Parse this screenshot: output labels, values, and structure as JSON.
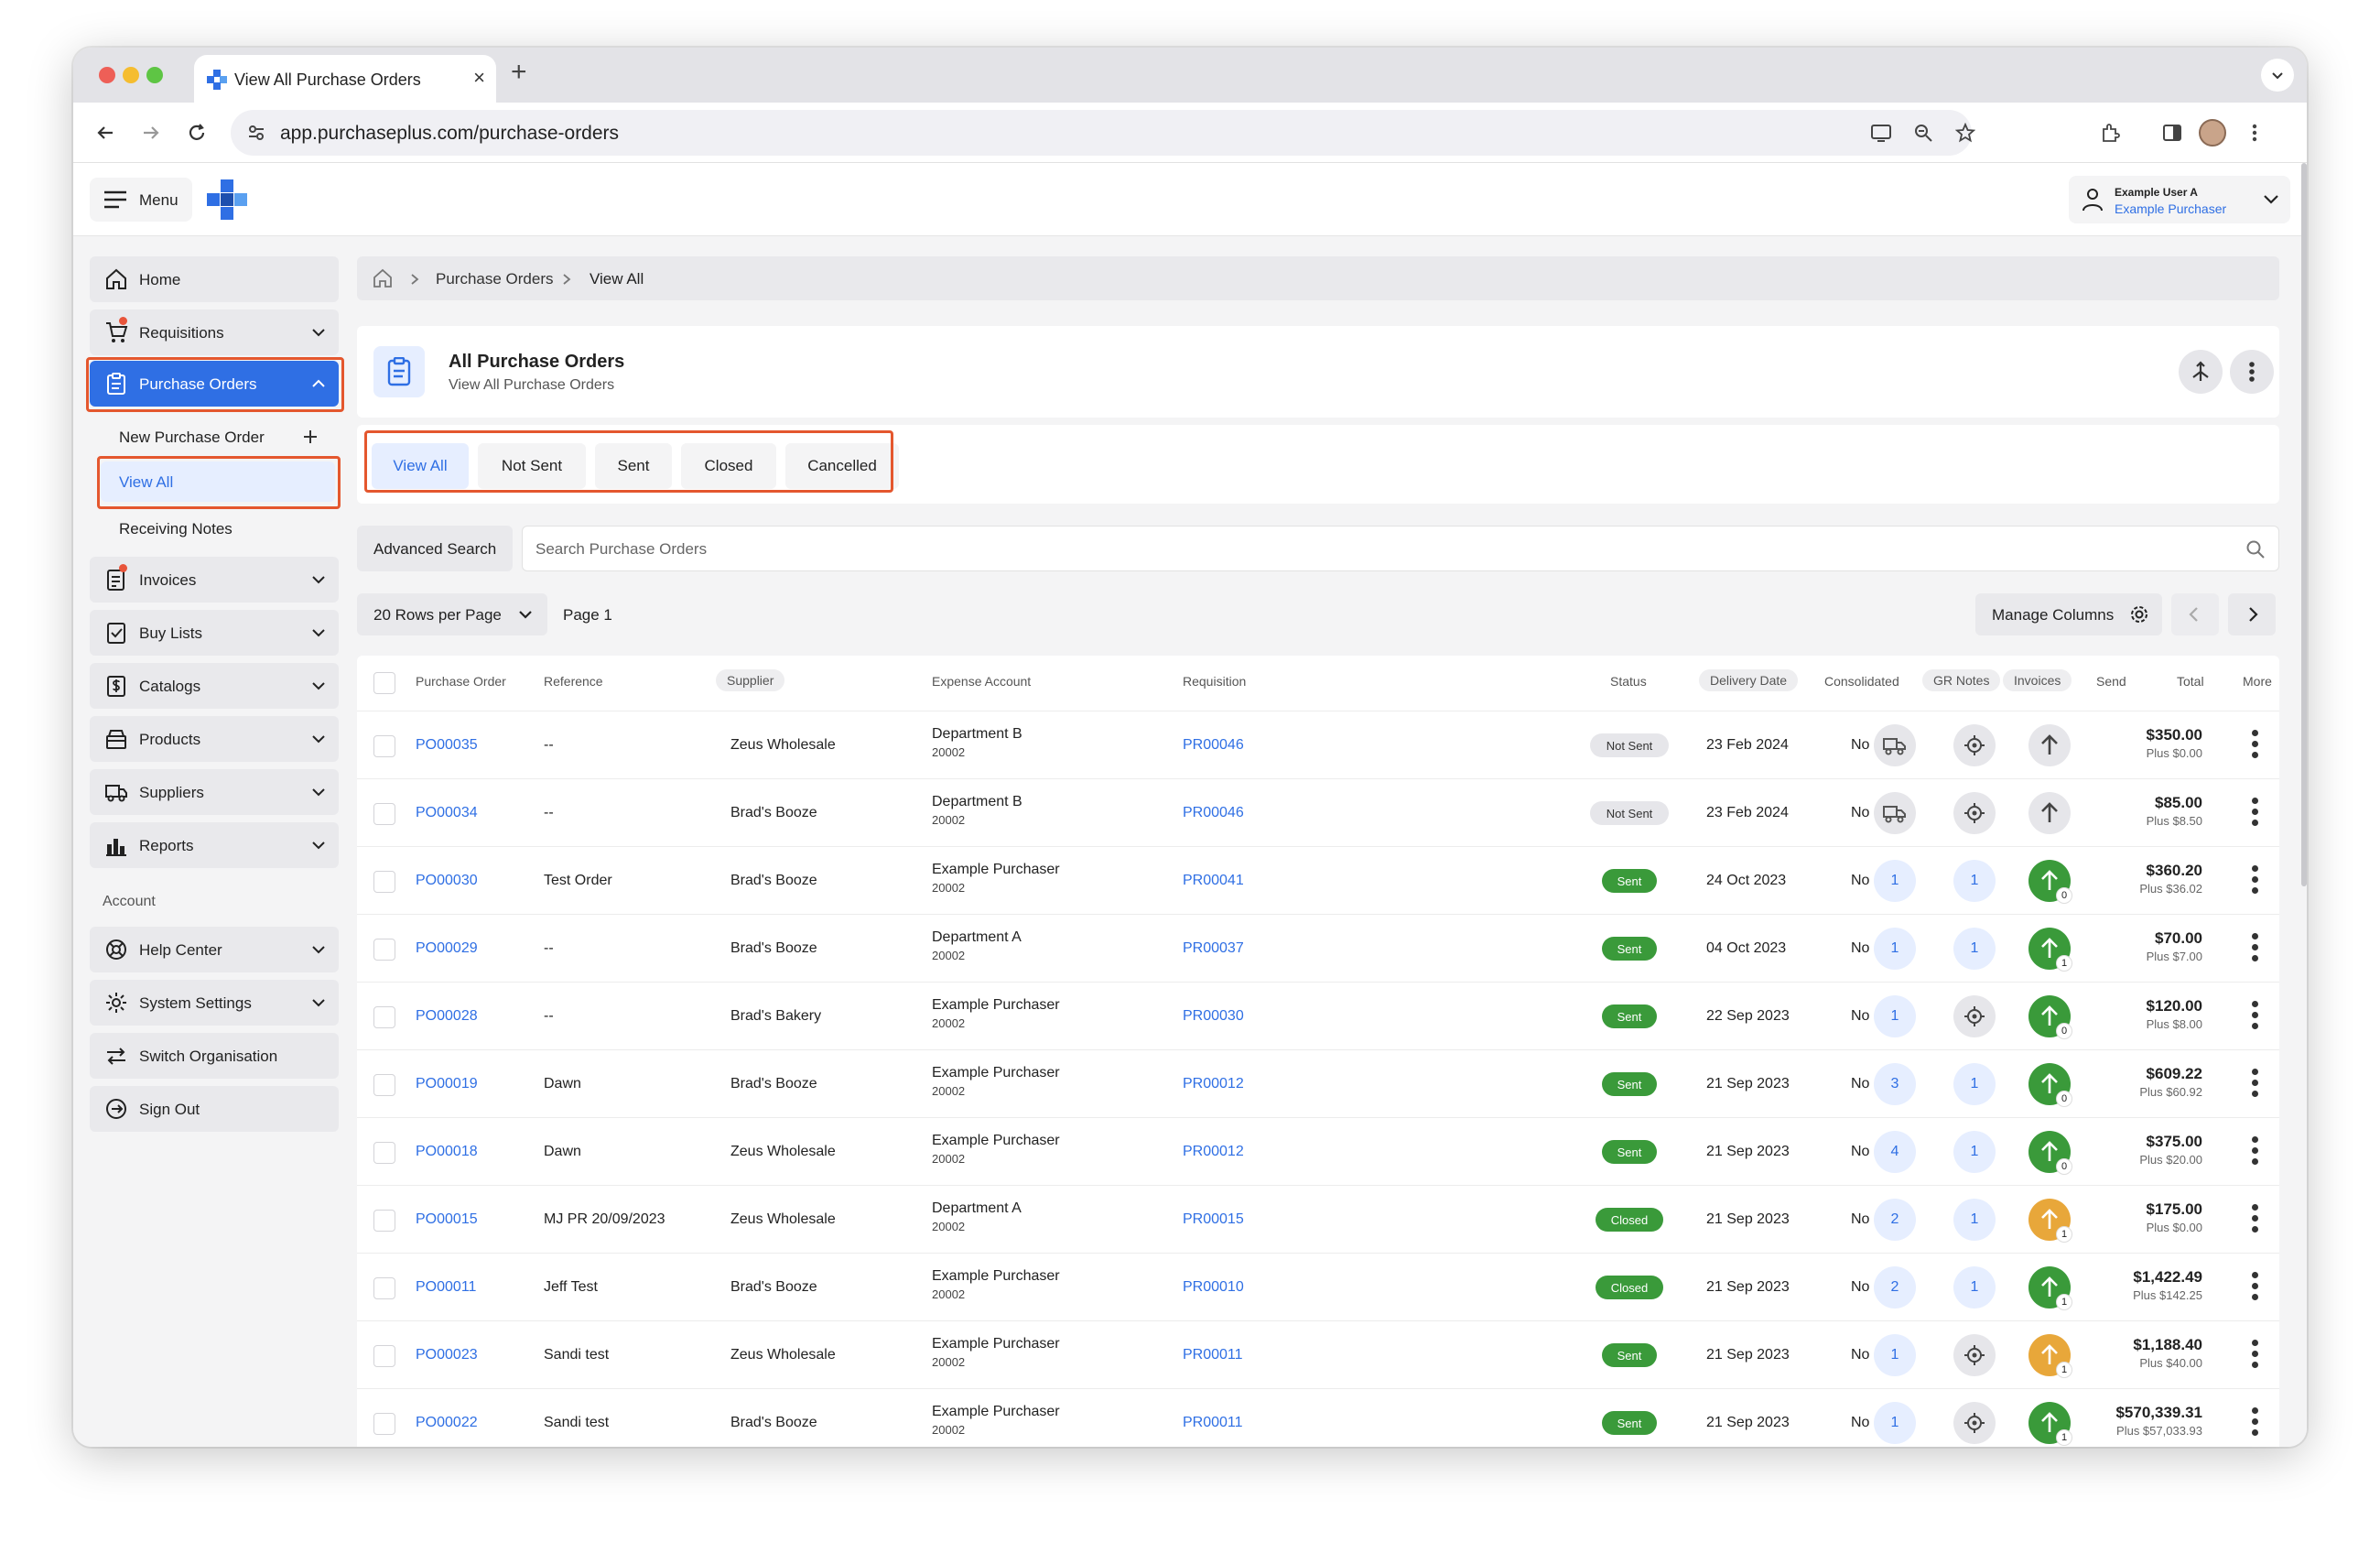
{
  "browser": {
    "tab_title": "View All Purchase Orders",
    "url": "app.purchaseplus.com/purchase-orders"
  },
  "header": {
    "menu_label": "Menu",
    "user_name": "Example User A",
    "user_org": "Example Purchaser"
  },
  "sidebar": {
    "items": [
      {
        "label": "Home",
        "icon": "home-icon"
      },
      {
        "label": "Requisitions",
        "icon": "cart-icon"
      },
      {
        "label": "Purchase Orders",
        "icon": "clipboard-icon"
      },
      {
        "label": "Invoices",
        "icon": "invoice-icon"
      },
      {
        "label": "Buy Lists",
        "icon": "checklist-icon"
      },
      {
        "label": "Catalogs",
        "icon": "dollar-doc-icon"
      },
      {
        "label": "Products",
        "icon": "box-icon"
      },
      {
        "label": "Suppliers",
        "icon": "truck-icon"
      },
      {
        "label": "Reports",
        "icon": "bar-chart-icon"
      }
    ],
    "sub_items": [
      "New Purchase Order",
      "View All",
      "Receiving Notes"
    ],
    "account_heading": "Account",
    "account_items": [
      {
        "label": "Help Center",
        "icon": "lifebuoy-icon"
      },
      {
        "label": "System Settings",
        "icon": "gear-icon"
      },
      {
        "label": "Switch Organisation",
        "icon": "switch-icon"
      },
      {
        "label": "Sign Out",
        "icon": "sign-out-icon"
      }
    ]
  },
  "breadcrumb": [
    "Purchase Orders",
    "View All"
  ],
  "page": {
    "title": "All Purchase Orders",
    "subtitle": "View All Purchase Orders"
  },
  "filter_tabs": [
    "View All",
    "Not Sent",
    "Sent",
    "Closed",
    "Cancelled"
  ],
  "search": {
    "advanced_label": "Advanced Search",
    "placeholder": "Search Purchase Orders"
  },
  "pagination": {
    "rows_per_page": "20 Rows per Page",
    "page_label": "Page 1",
    "manage_columns": "Manage Columns"
  },
  "table": {
    "columns": [
      "Purchase Order",
      "Reference",
      "Supplier",
      "Expense Account",
      "Requisition",
      "Status",
      "Delivery Date",
      "Consolidated",
      "GR Notes",
      "Invoices",
      "Send",
      "Total",
      "More"
    ],
    "rows": [
      {
        "po": "PO00035",
        "ref": "--",
        "supplier": "Zeus Wholesale",
        "account": "Department B",
        "account_code": "20002",
        "req": "PR00046",
        "status": "Not Sent",
        "date": "23 Feb 2024",
        "consolidated": "No",
        "gr": "",
        "inv": "",
        "send_badge": "",
        "total": "$350.00",
        "tax": "Plus $0.00"
      },
      {
        "po": "PO00034",
        "ref": "--",
        "supplier": "Brad's Booze",
        "account": "Department B",
        "account_code": "20002",
        "req": "PR00046",
        "status": "Not Sent",
        "date": "23 Feb 2024",
        "consolidated": "No",
        "gr": "",
        "inv": "",
        "send_badge": "",
        "total": "$85.00",
        "tax": "Plus $8.50"
      },
      {
        "po": "PO00030",
        "ref": "Test Order",
        "supplier": "Brad's Booze",
        "account": "Example Purchaser",
        "account_code": "20002",
        "req": "PR00041",
        "status": "Sent",
        "date": "24 Oct 2023",
        "consolidated": "No",
        "gr": "1",
        "inv": "1",
        "send_badge": "0",
        "total": "$360.20",
        "tax": "Plus $36.02"
      },
      {
        "po": "PO00029",
        "ref": "--",
        "supplier": "Brad's Booze",
        "account": "Department A",
        "account_code": "20002",
        "req": "PR00037",
        "status": "Sent",
        "date": "04 Oct 2023",
        "consolidated": "No",
        "gr": "1",
        "inv": "1",
        "send_badge": "1",
        "total": "$70.00",
        "tax": "Plus $7.00"
      },
      {
        "po": "PO00028",
        "ref": "--",
        "supplier": "Brad's Bakery",
        "account": "Example Purchaser",
        "account_code": "20002",
        "req": "PR00030",
        "status": "Sent",
        "date": "22 Sep 2023",
        "consolidated": "No",
        "gr": "1",
        "inv": "",
        "send_badge": "0",
        "total": "$120.00",
        "tax": "Plus $8.00"
      },
      {
        "po": "PO00019",
        "ref": "Dawn",
        "supplier": "Brad's Booze",
        "account": "Example Purchaser",
        "account_code": "20002",
        "req": "PR00012",
        "status": "Sent",
        "date": "21 Sep 2023",
        "consolidated": "No",
        "gr": "3",
        "inv": "1",
        "send_badge": "0",
        "total": "$609.22",
        "tax": "Plus $60.92"
      },
      {
        "po": "PO00018",
        "ref": "Dawn",
        "supplier": "Zeus Wholesale",
        "account": "Example Purchaser",
        "account_code": "20002",
        "req": "PR00012",
        "status": "Sent",
        "date": "21 Sep 2023",
        "consolidated": "No",
        "gr": "4",
        "inv": "1",
        "send_badge": "0",
        "total": "$375.00",
        "tax": "Plus $20.00"
      },
      {
        "po": "PO00015",
        "ref": "MJ PR 20/09/2023",
        "supplier": "Zeus Wholesale",
        "account": "Department A",
        "account_code": "20002",
        "req": "PR00015",
        "status": "Closed",
        "date": "21 Sep 2023",
        "consolidated": "No",
        "gr": "2",
        "inv": "1",
        "send_badge": "1",
        "total": "$175.00",
        "tax": "Plus $0.00"
      },
      {
        "po": "PO00011",
        "ref": "Jeff Test",
        "supplier": "Brad's Booze",
        "account": "Example Purchaser",
        "account_code": "20002",
        "req": "PR00010",
        "status": "Closed",
        "date": "21 Sep 2023",
        "consolidated": "No",
        "gr": "2",
        "inv": "1",
        "send_badge": "1",
        "total": "$1,422.49",
        "tax": "Plus $142.25"
      },
      {
        "po": "PO00023",
        "ref": "Sandi test",
        "supplier": "Zeus Wholesale",
        "account": "Example Purchaser",
        "account_code": "20002",
        "req": "PR00011",
        "status": "Sent",
        "date": "21 Sep 2023",
        "consolidated": "No",
        "gr": "1",
        "inv": "",
        "send_badge": "1",
        "total": "$1,188.40",
        "tax": "Plus $40.00"
      },
      {
        "po": "PO00022",
        "ref": "Sandi test",
        "supplier": "Brad's Booze",
        "account": "Example Purchaser",
        "account_code": "20002",
        "req": "PR00011",
        "status": "Sent",
        "date": "21 Sep 2023",
        "consolidated": "No",
        "gr": "1",
        "inv": "",
        "send_badge": "1",
        "total": "$570,339.31",
        "tax": "Plus $57,033.93"
      }
    ]
  },
  "colors": {
    "accent": "#2f6fe4",
    "highlight": "#e4572e",
    "sent": "#3a9a3a",
    "warning": "#e8a73a"
  }
}
